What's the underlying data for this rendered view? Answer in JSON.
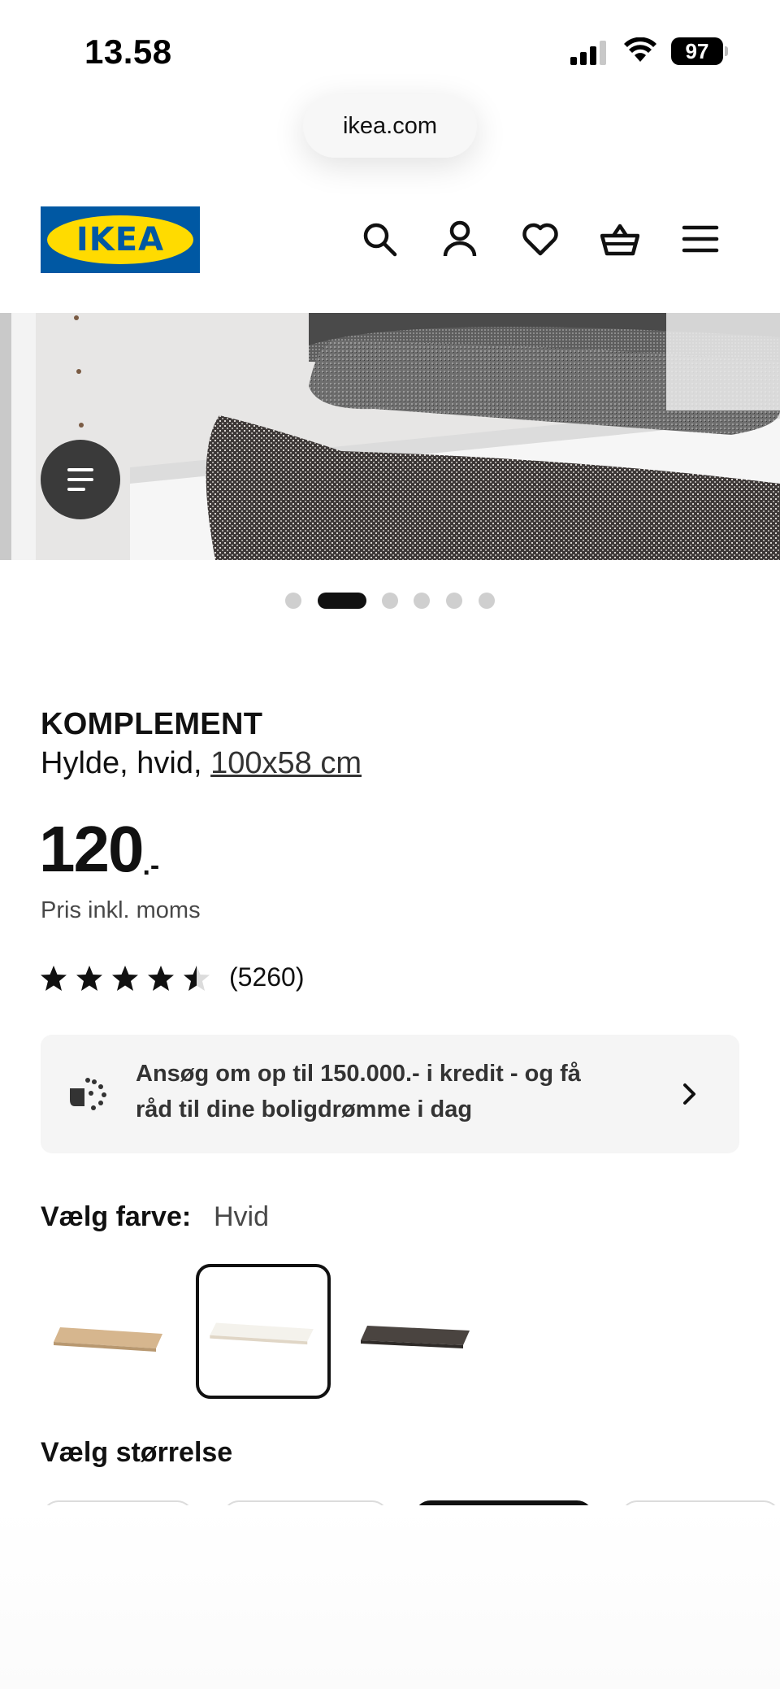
{
  "status_bar": {
    "time": "13.58",
    "battery": "97"
  },
  "browser": {
    "url": "ikea.com"
  },
  "header": {
    "logo_text": "IKEA",
    "icons": [
      "search-icon",
      "user-icon",
      "heart-icon",
      "basket-icon",
      "menu-icon"
    ]
  },
  "carousel": {
    "total": 6,
    "active_index": 1
  },
  "product": {
    "name": "KOMPLEMENT",
    "desc_prefix": "Hylde, hvid, ",
    "size_link": "100x58 cm",
    "price_int": "120",
    "price_dec": ".-",
    "price_note": "Pris inkl. moms",
    "rating": 4.5,
    "rating_count": "(5260)"
  },
  "credit_banner": {
    "text_line1": "Ansøg om op til 150.000.- i kredit - og få",
    "text_line2": "råd til dine boligdrømme i dag"
  },
  "color_selector": {
    "label": "Vælg farve:",
    "value": "Hvid",
    "options": [
      {
        "name": "wood",
        "color": "#d4b48c"
      },
      {
        "name": "white",
        "color": "#f4f2ec",
        "selected": true
      },
      {
        "name": "dark",
        "color": "#4a4440"
      }
    ]
  },
  "size_selector": {
    "label": "Vælg størrelse"
  },
  "colors": {
    "text": "#111111",
    "muted": "#484848",
    "banner_bg": "#f5f5f5",
    "ikea_blue": "#0058a3",
    "ikea_yellow": "#ffdb00"
  }
}
